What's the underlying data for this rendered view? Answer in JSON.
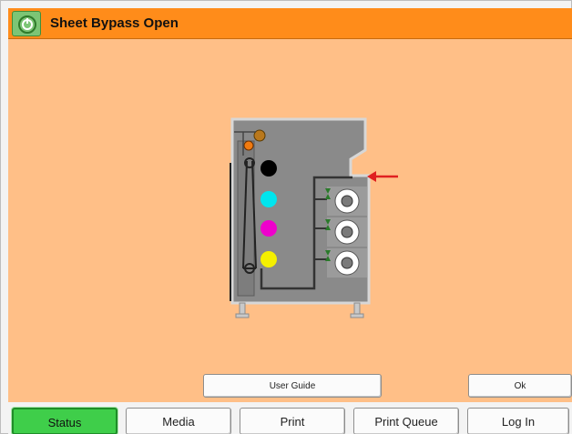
{
  "window": {
    "title": "Sheet Bypass Open",
    "power_icon": "power-icon",
    "colors": {
      "titlebar": "#ff8c1a",
      "content_bg": "#ffbf87",
      "status_active": "#3fce4a",
      "arrow": "#e02020"
    }
  },
  "diagram": {
    "toner_colors": [
      "#000000",
      "#00e5ee",
      "#ee00cc",
      "#f5f000"
    ],
    "paper_trays": 3
  },
  "actions": {
    "user_guide_label": "User Guide",
    "ok_label": "Ok"
  },
  "nav": {
    "status_label": "Status",
    "media_label": "Media",
    "print_label": "Print",
    "print_queue_label": "Print Queue",
    "log_in_label": "Log In",
    "active": "Status"
  }
}
